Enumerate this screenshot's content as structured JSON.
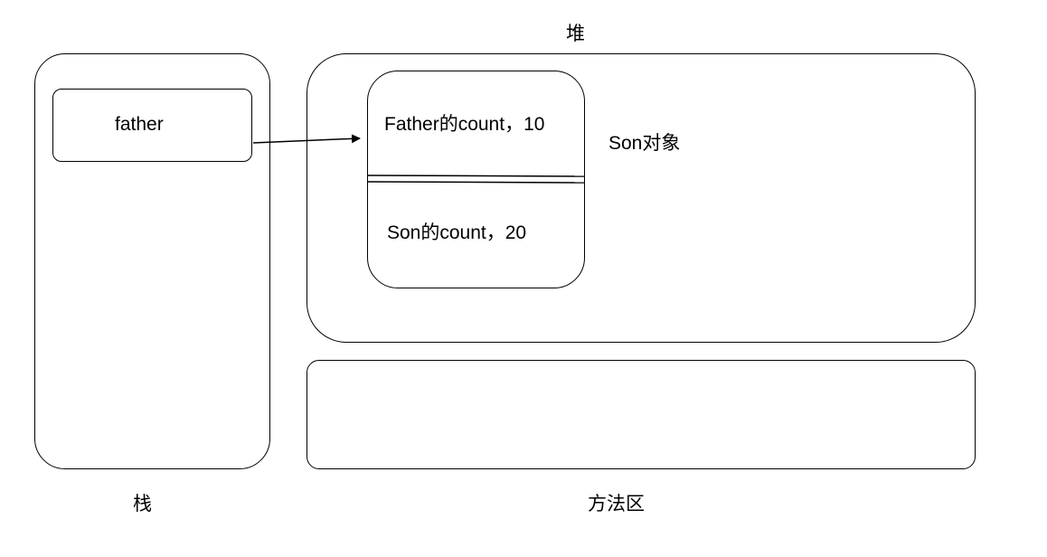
{
  "diagram": {
    "stack": {
      "title": "栈",
      "reference": {
        "label": "father"
      }
    },
    "heap": {
      "title": "堆",
      "object": {
        "label": "Son对象",
        "fields": [
          {
            "label": "Father的count，10"
          },
          {
            "label": "Son的count，20"
          }
        ]
      }
    },
    "method_area": {
      "title": "方法区"
    },
    "colors": {
      "stroke": "#000000",
      "background": "#ffffff"
    }
  }
}
